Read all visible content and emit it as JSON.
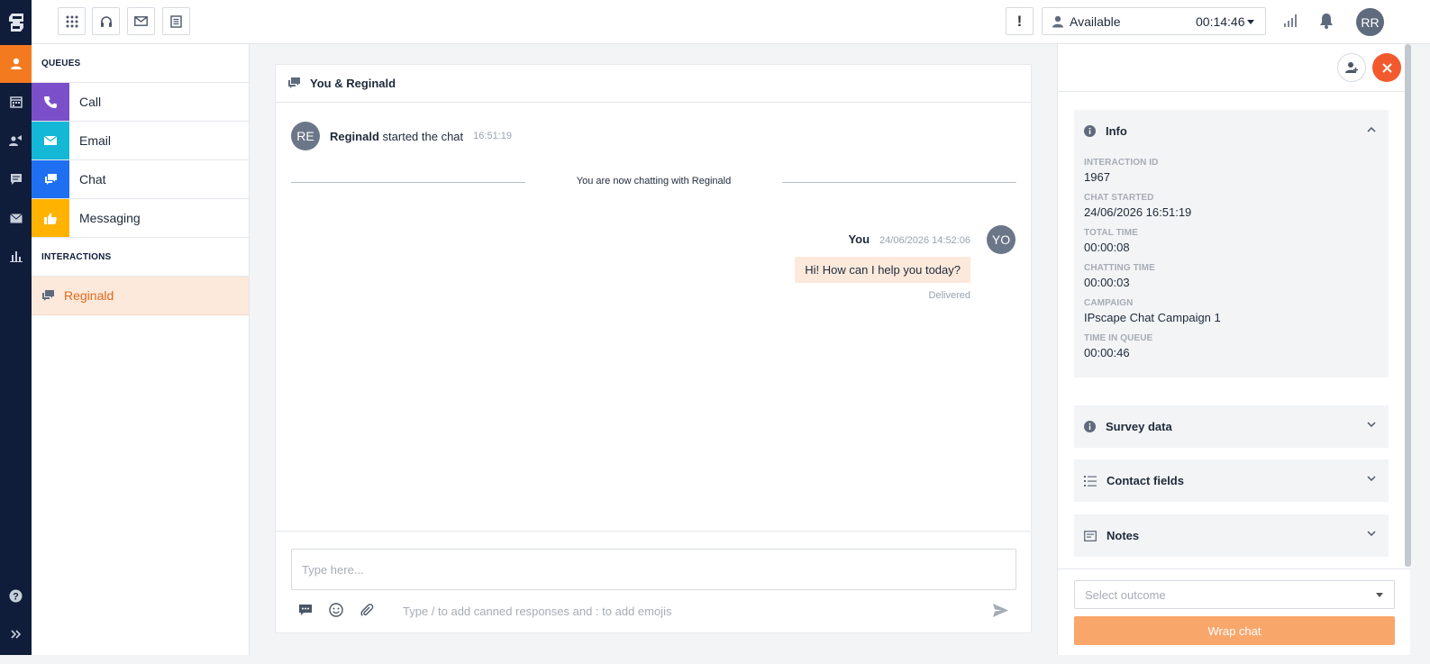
{
  "topbar": {
    "status_label": "Available",
    "timer": "00:14:46",
    "alert_glyph": "!",
    "user_initials": "RR"
  },
  "queues": {
    "heading": "QUEUES",
    "items": [
      {
        "label": "Call",
        "color": "#7b4fc9",
        "icon": "phone-icon"
      },
      {
        "label": "Email",
        "color": "#14b7d6",
        "icon": "envelope-icon"
      },
      {
        "label": "Chat",
        "color": "#1f6ff2",
        "icon": "chat-bubbles-icon"
      },
      {
        "label": "Messaging",
        "color": "#ffb300",
        "icon": "thumbs-up-icon"
      }
    ]
  },
  "interactions": {
    "heading": "INTERACTIONS",
    "items": [
      {
        "label": "Reginald",
        "icon": "chat-bubbles-icon"
      }
    ]
  },
  "chat": {
    "title": "You & Reginald",
    "start": {
      "avatar": "RE",
      "name": "Reginald",
      "text": "started the chat",
      "time": "16:51:19"
    },
    "divider_text": "You are now chatting with Reginald",
    "message": {
      "sender": "You",
      "datetime": "24/06/2026 14:52:06",
      "avatar": "YO",
      "text": "Hi! How can I help you today?",
      "status": "Delivered"
    },
    "input_placeholder": "Type here...",
    "hint": "Type / to add canned responses and : to add emojis"
  },
  "info": {
    "title": "Info",
    "fields": [
      {
        "label": "INTERACTION ID",
        "value": "1967"
      },
      {
        "label": "CHAT STARTED",
        "value": "24/06/2026 16:51:19"
      },
      {
        "label": "TOTAL TIME",
        "value": "00:00:08"
      },
      {
        "label": "CHATTING TIME",
        "value": "00:00:03"
      },
      {
        "label": "CAMPAIGN",
        "value": "IPscape Chat Campaign 1"
      },
      {
        "label": "TIME IN QUEUE",
        "value": "00:00:46"
      }
    ]
  },
  "sections": {
    "survey": "Survey data",
    "contact_fields": "Contact fields",
    "notes": "Notes"
  },
  "outcome": {
    "placeholder": "Select outcome",
    "wrap_label": "Wrap chat"
  },
  "colors": {
    "rail": "#0f1d3a",
    "accent": "#f47a20",
    "close": "#f25a2e",
    "wrap": "#f9a66b",
    "active_item": "#fde9dc"
  }
}
